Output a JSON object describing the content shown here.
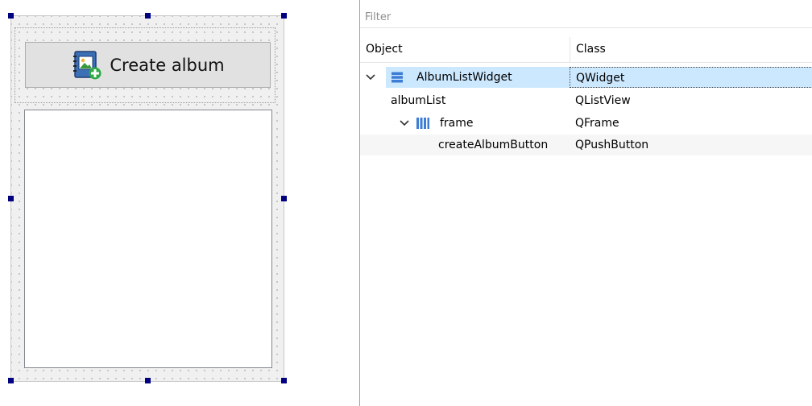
{
  "form": {
    "create_button_label": "Create album"
  },
  "inspector": {
    "filter_placeholder": "Filter",
    "headers": {
      "object": "Object",
      "class": "Class"
    },
    "rows": [
      {
        "object": "AlbumListWidget",
        "class": "QWidget",
        "icon": "vertical-layout-icon",
        "selected": true
      },
      {
        "object": "albumList",
        "class": "QListView"
      },
      {
        "object": "frame",
        "class": "QFrame",
        "icon": "horizontal-layout-icon"
      },
      {
        "object": "createAlbumButton",
        "class": "QPushButton"
      }
    ]
  },
  "colors": {
    "selection": "#cce8ff",
    "handle": "#000080",
    "form_bg": "#f0f0f0"
  }
}
